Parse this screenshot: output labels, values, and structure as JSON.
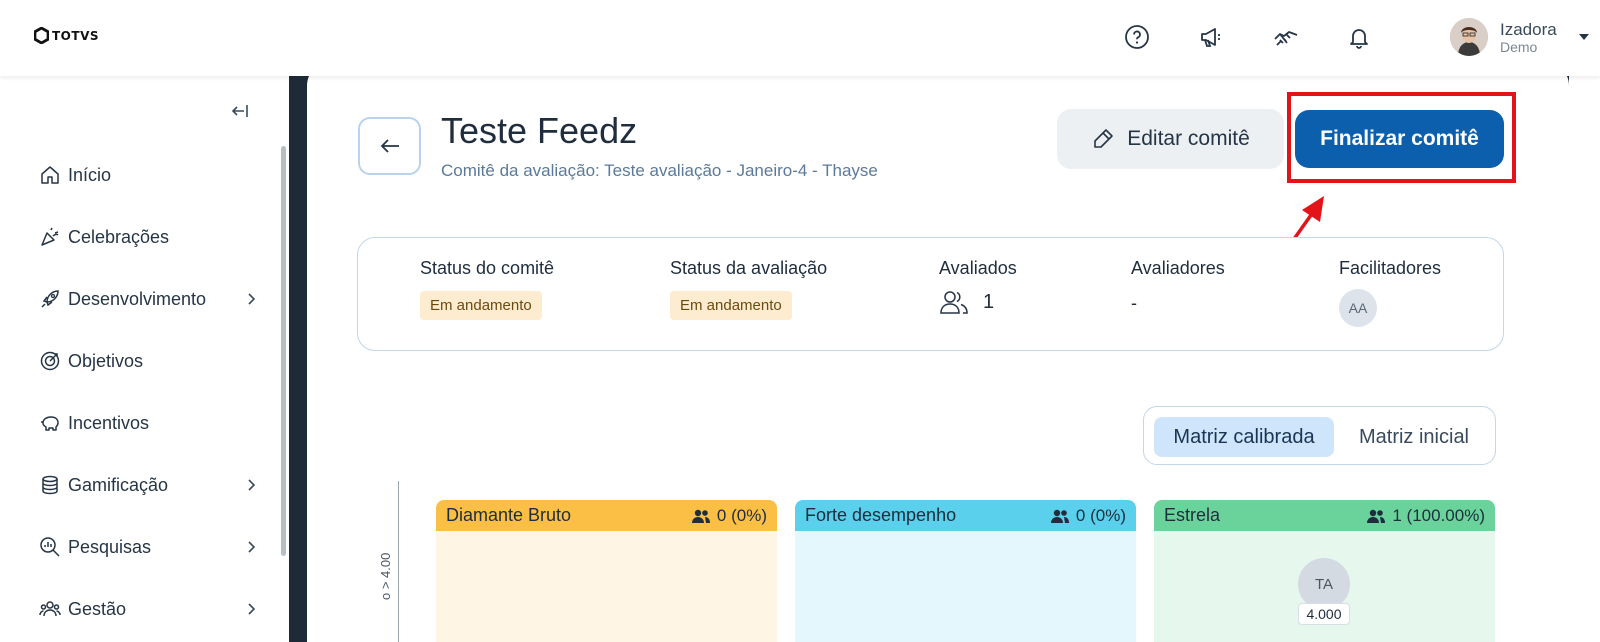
{
  "brand": {
    "logo_text": "TOTVS"
  },
  "topbar": {
    "icons": [
      "help-icon",
      "megaphone-icon",
      "handshake-icon",
      "bell-icon"
    ],
    "user": {
      "name": "Izadora",
      "role": "Demo"
    }
  },
  "sidebar": {
    "items": [
      {
        "label": "Início",
        "icon": "home-icon",
        "has_submenu": false
      },
      {
        "label": "Celebrações",
        "icon": "party-icon",
        "has_submenu": false
      },
      {
        "label": "Desenvolvimento",
        "icon": "rocket-icon",
        "has_submenu": true
      },
      {
        "label": "Objetivos",
        "icon": "target-icon",
        "has_submenu": false
      },
      {
        "label": "Incentivos",
        "icon": "piggy-bank-icon",
        "has_submenu": false
      },
      {
        "label": "Gamificação",
        "icon": "coins-icon",
        "has_submenu": true
      },
      {
        "label": "Pesquisas",
        "icon": "search-chart-icon",
        "has_submenu": true
      },
      {
        "label": "Gestão",
        "icon": "team-icon",
        "has_submenu": true
      }
    ]
  },
  "header": {
    "title": "Teste Feedz",
    "subtitle": "Comitê da avaliação: Teste avaliação - Janeiro-4 - Thayse",
    "edit_label": "Editar comitê",
    "finalize_label": "Finalizar comitê"
  },
  "summary": {
    "committee_status": {
      "label": "Status do comitê",
      "value": "Em andamento"
    },
    "evaluation_status": {
      "label": "Status da avaliação",
      "value": "Em andamento"
    },
    "evaluated": {
      "label": "Avaliados",
      "value": "1"
    },
    "evaluators": {
      "label": "Avaliadores",
      "value": "-"
    },
    "facilitators": {
      "label": "Facilitadores",
      "initials": "AA"
    }
  },
  "matrix_toggle": {
    "active": "Matriz calibrada",
    "inactive": "Matriz inicial"
  },
  "matrix": {
    "y_axis_label": "o > 4.00",
    "cells": [
      {
        "title": "Diamante Bruto",
        "count": "0 (0%)",
        "head_color": "#fbbf45",
        "body_color": "#fef5e4"
      },
      {
        "title": "Forte desempenho",
        "count": "0 (0%)",
        "head_color": "#5ad0ec",
        "body_color": "#e4f7fc"
      },
      {
        "title": "Estrela",
        "count": "1 (100.00%)",
        "head_color": "#6ad39b",
        "body_color": "#e6f7ee",
        "member": {
          "initials": "TA",
          "score": "4.000"
        }
      }
    ]
  },
  "colors": {
    "primary": "#0b5fad",
    "highlight": "#e3131a",
    "frame": "#1e2a38"
  }
}
